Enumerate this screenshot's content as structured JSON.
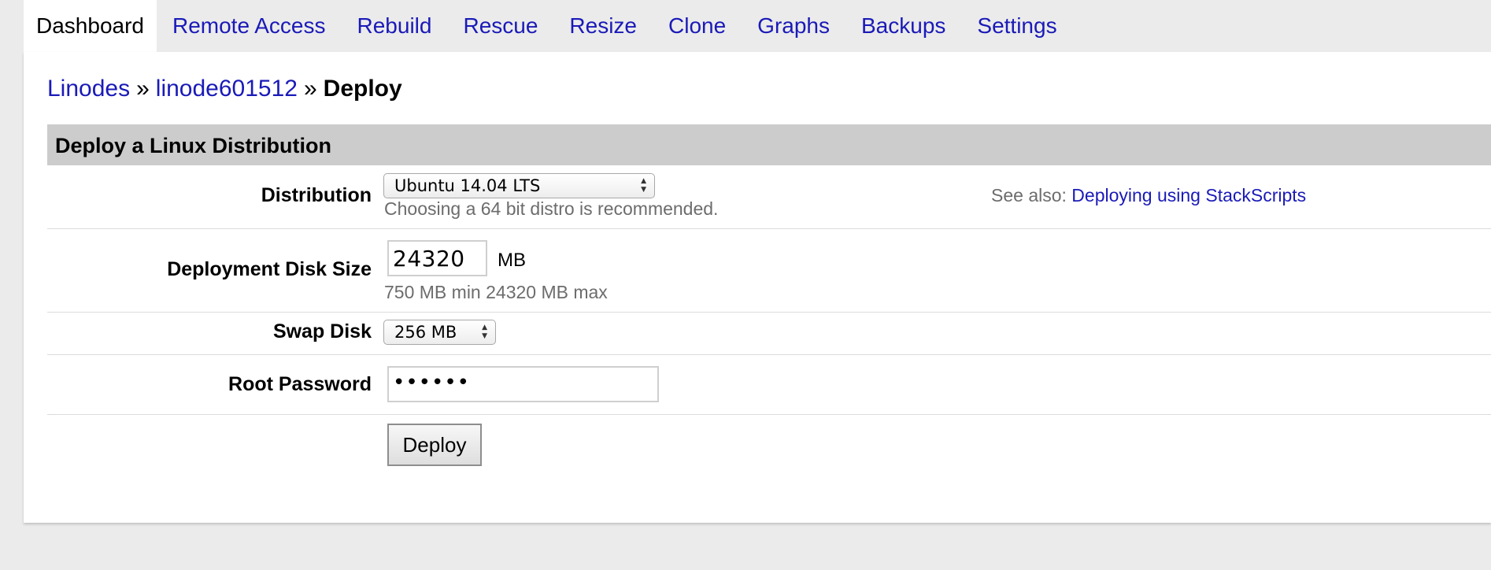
{
  "tabs": [
    {
      "label": "Dashboard",
      "active": true
    },
    {
      "label": "Remote Access"
    },
    {
      "label": "Rebuild"
    },
    {
      "label": "Rescue"
    },
    {
      "label": "Resize"
    },
    {
      "label": "Clone"
    },
    {
      "label": "Graphs"
    },
    {
      "label": "Backups"
    },
    {
      "label": "Settings"
    }
  ],
  "breadcrumb": {
    "root": "Linodes",
    "separator": "»",
    "linode": "linode601512",
    "current": "Deploy"
  },
  "section": {
    "title": "Deploy a Linux Distribution"
  },
  "form": {
    "distribution": {
      "label": "Distribution",
      "value": "Ubuntu 14.04 LTS",
      "hint": "Choosing a 64 bit distro is recommended."
    },
    "see_also": {
      "prefix": "See also:",
      "link": "Deploying using StackScripts"
    },
    "disk_size": {
      "label": "Deployment Disk Size",
      "value": "24320",
      "unit": "MB",
      "hint": "750 MB min 24320 MB max"
    },
    "swap_disk": {
      "label": "Swap Disk",
      "value": "256 MB"
    },
    "root_password": {
      "label": "Root Password",
      "masked_value": "••••••"
    },
    "deploy_button": "Deploy"
  },
  "colors": {
    "link": "#1a1ab8",
    "header_bg": "#cccccc",
    "page_bg": "#ebebeb",
    "hint_text": "#6c6c6c"
  }
}
